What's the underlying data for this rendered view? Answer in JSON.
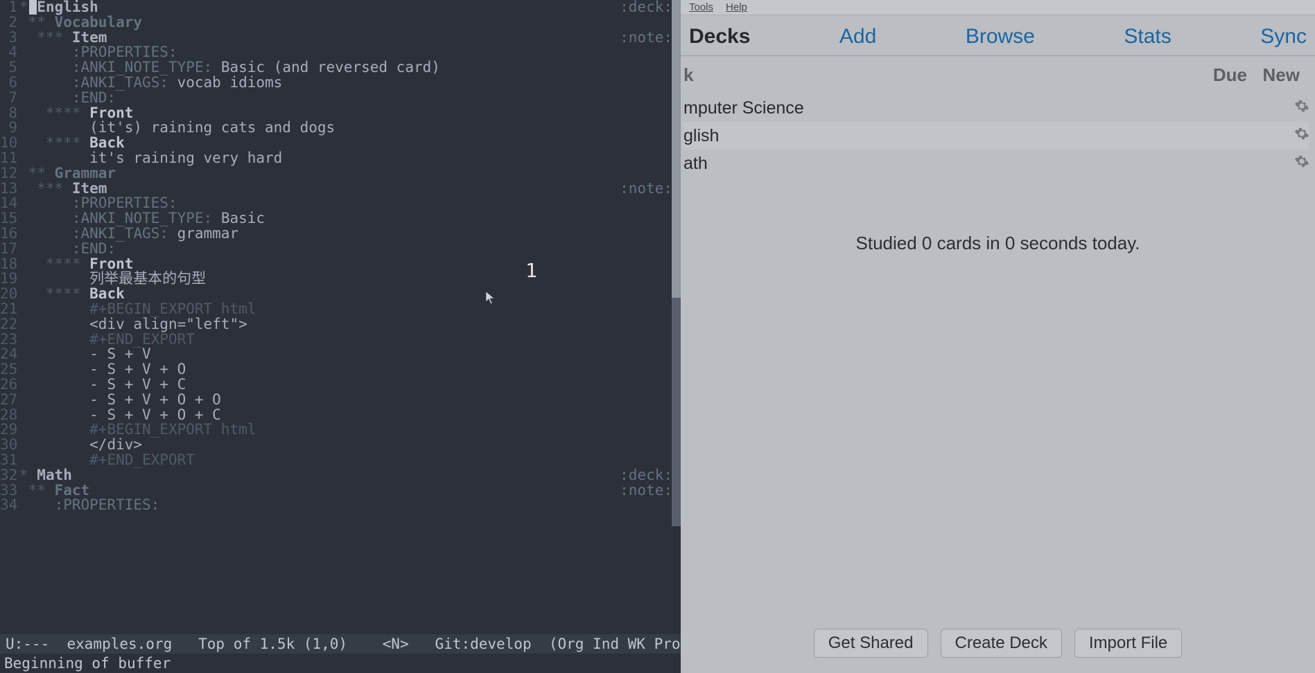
{
  "editor": {
    "line_numbers": [
      "1",
      "2",
      "3",
      "4",
      "5",
      "6",
      "7",
      "8",
      "9",
      "10",
      "11",
      "12",
      "13",
      "14",
      "15",
      "16",
      "17",
      "18",
      "19",
      "20",
      "21",
      "22",
      "23",
      "24",
      "25",
      "26",
      "27",
      "28",
      "29",
      "30",
      "31",
      "32",
      "33",
      "34"
    ],
    "headings": {
      "english": "English",
      "vocabulary": "Vocabulary",
      "item1": "Item",
      "front1": "Front",
      "back1": "Back",
      "grammar": "Grammar",
      "item2": "Item",
      "front2": "Front",
      "back2": "Back",
      "math": "Math",
      "fact": "Fact"
    },
    "tags": {
      "deck": ":deck:",
      "note": ":note:"
    },
    "props": {
      "begin": ":PROPERTIES:",
      "note_type_key": ":ANKI_NOTE_TYPE:",
      "tags_key": ":ANKI_TAGS:",
      "end": ":END:",
      "note_type_v1": "Basic (and reversed card)",
      "tags_v1": "vocab idioms",
      "note_type_v2": "Basic",
      "tags_v2": "grammar"
    },
    "content": {
      "front1": "(it's) raining cats and dogs",
      "back1": "it's raining very hard",
      "front2": "列举最基本的句型",
      "export_begin": "#+BEGIN_EXPORT html",
      "export_end": "#+END_EXPORT",
      "div_open": "<div align=\"left\">",
      "div_close": "</div>",
      "li1": "- S + V",
      "li2": "- S + V + O",
      "li3": "- S + V + C",
      "li4": "- S + V + O + O",
      "li5": "- S + V + O + C"
    },
    "overlay_num": "1",
    "modeline": "U:---  examples.org   Top of 1.5k (1,0)    <N>   Git:develop  (Org Ind WK Projectile[anki-edi",
    "minibuffer": "Beginning of buffer"
  },
  "anki": {
    "menu": {
      "tools": "Tools",
      "help": "Help"
    },
    "tabs": {
      "decks": "Decks",
      "add": "Add",
      "browse": "Browse",
      "stats": "Stats",
      "sync": "Sync"
    },
    "header": {
      "deck_col": "k",
      "due": "Due",
      "new": "New"
    },
    "decks": [
      {
        "name": "mputer Science"
      },
      {
        "name": "glish"
      },
      {
        "name": "ath"
      }
    ],
    "study_line": "Studied 0 cards in 0 seconds today.",
    "buttons": {
      "get_shared": "Get Shared",
      "create_deck": "Create Deck",
      "import_file": "Import File"
    }
  }
}
